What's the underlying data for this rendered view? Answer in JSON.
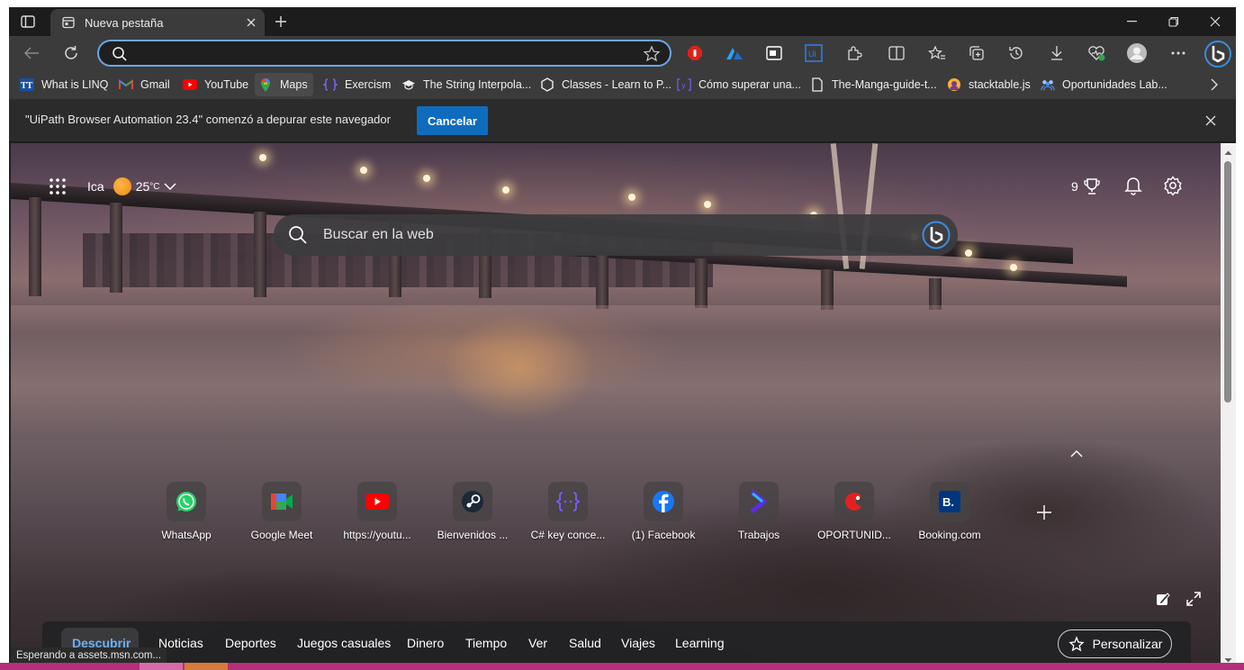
{
  "tab": {
    "title": "Nueva pestaña"
  },
  "address_bar": {
    "value": "",
    "placeholder": ""
  },
  "bookmarks": [
    {
      "label": "What is LINQ",
      "icon": "tt-icon"
    },
    {
      "label": "Gmail",
      "icon": "gmail-icon"
    },
    {
      "label": "YouTube",
      "icon": "youtube-icon"
    },
    {
      "label": "Maps",
      "icon": "maps-icon"
    },
    {
      "label": "Exercism",
      "icon": "exercism-icon"
    },
    {
      "label": "The String Interpola...",
      "icon": "graduation-cap-icon"
    },
    {
      "label": "Classes - Learn to P...",
      "icon": "hexagon-icon"
    },
    {
      "label": "Cómo superar una...",
      "icon": "bracket-y-icon"
    },
    {
      "label": "The-Manga-guide-t...",
      "icon": "document-icon"
    },
    {
      "label": "stacktable.js",
      "icon": "stacktable-icon"
    },
    {
      "label": "Oportunidades Lab...",
      "icon": "people-icon"
    }
  ],
  "infobar": {
    "message": "\"UiPath Browser Automation 23.4\" comenzó a depurar este navegador",
    "cancel_label": "Cancelar"
  },
  "page": {
    "weather": {
      "city": "Ica",
      "temp": "25",
      "unit": "°C"
    },
    "rewards_count": "9",
    "search_placeholder": "Buscar en la web",
    "quick_links": [
      {
        "label": "WhatsApp",
        "icon": "whatsapp-icon"
      },
      {
        "label": "Google Meet",
        "icon": "google-meet-icon"
      },
      {
        "label": "https://youtu...",
        "icon": "youtube-icon"
      },
      {
        "label": "Bienvenidos ...",
        "icon": "steam-icon"
      },
      {
        "label": "C# key conce...",
        "icon": "code-braces-icon"
      },
      {
        "label": "(1) Facebook",
        "icon": "facebook-icon"
      },
      {
        "label": "Trabajos",
        "icon": "chevron-logo-icon"
      },
      {
        "label": "OPORTUNID...",
        "icon": "red-logo-icon"
      },
      {
        "label": "Booking.com",
        "icon": "booking-icon"
      }
    ],
    "feed_tabs": [
      "Descubrir",
      "Noticias",
      "Deportes",
      "Juegos casuales",
      "Dinero",
      "Tiempo",
      "Ver",
      "Salud",
      "Viajes",
      "Learning"
    ],
    "personalize_label": "Personalizar"
  },
  "status_text": "Esperando a assets.msn.com...",
  "colors": {
    "accent": "#0f6cbd",
    "address_border": "#6aa7e6",
    "active_feed_tab": "#6ab0f3"
  }
}
